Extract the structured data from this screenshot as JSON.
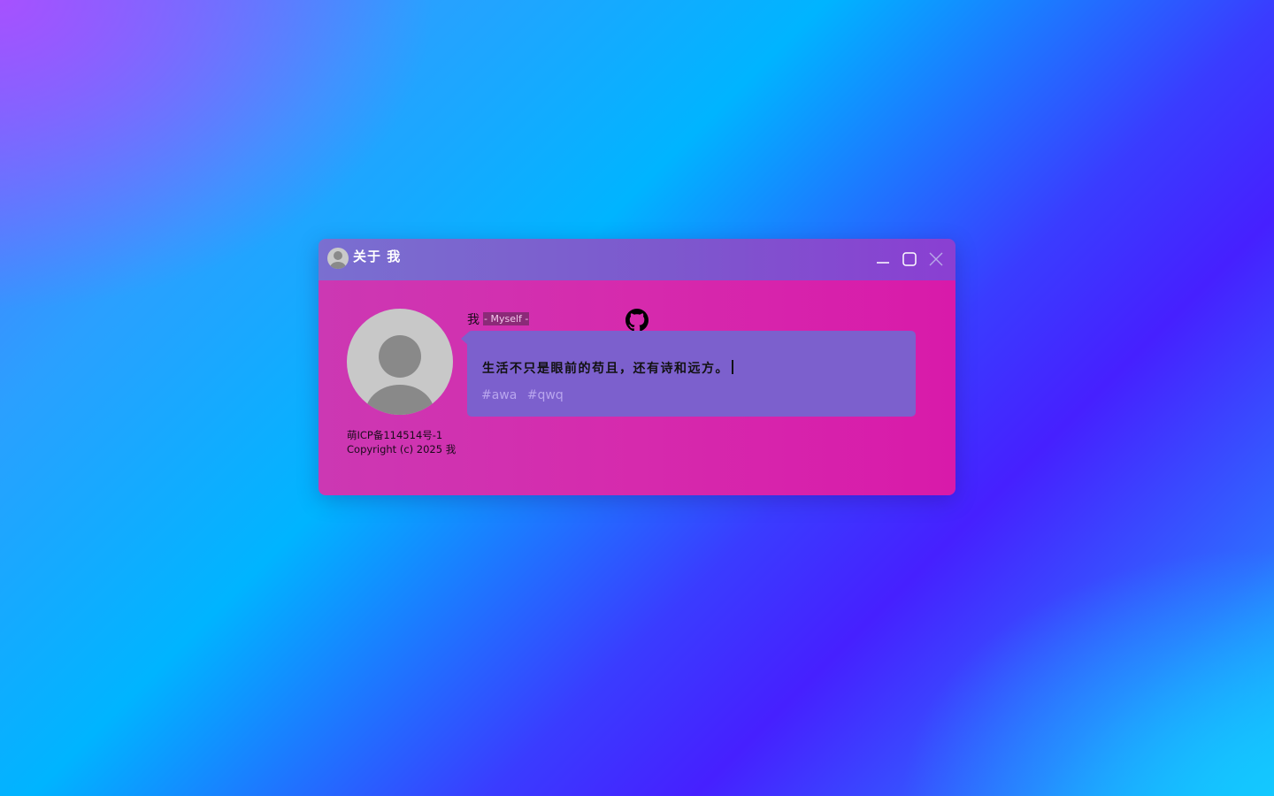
{
  "window": {
    "title": "关于 我"
  },
  "profile": {
    "name": "我",
    "subtitle": "- Myself -",
    "motto": "生活不只是眼前的苟且，还有诗和远方。",
    "tags": [
      "#awa",
      "#qwq"
    ]
  },
  "footer": {
    "icp": "萌ICP备114514号-1",
    "copyright": "Copyright (c) 2025 我"
  },
  "icons": {
    "window_avatar": "user-avatar-icon",
    "minimize": "minimize-icon",
    "maximize": "maximize-icon",
    "close": "close-icon",
    "github": "github-icon"
  },
  "colors": {
    "titlebar": "#7d58cd",
    "content": "#d62aad",
    "bubble": "#7c60cd",
    "subtitle_bg": "#8b2a78",
    "tag_text": "#b9a6ee"
  }
}
